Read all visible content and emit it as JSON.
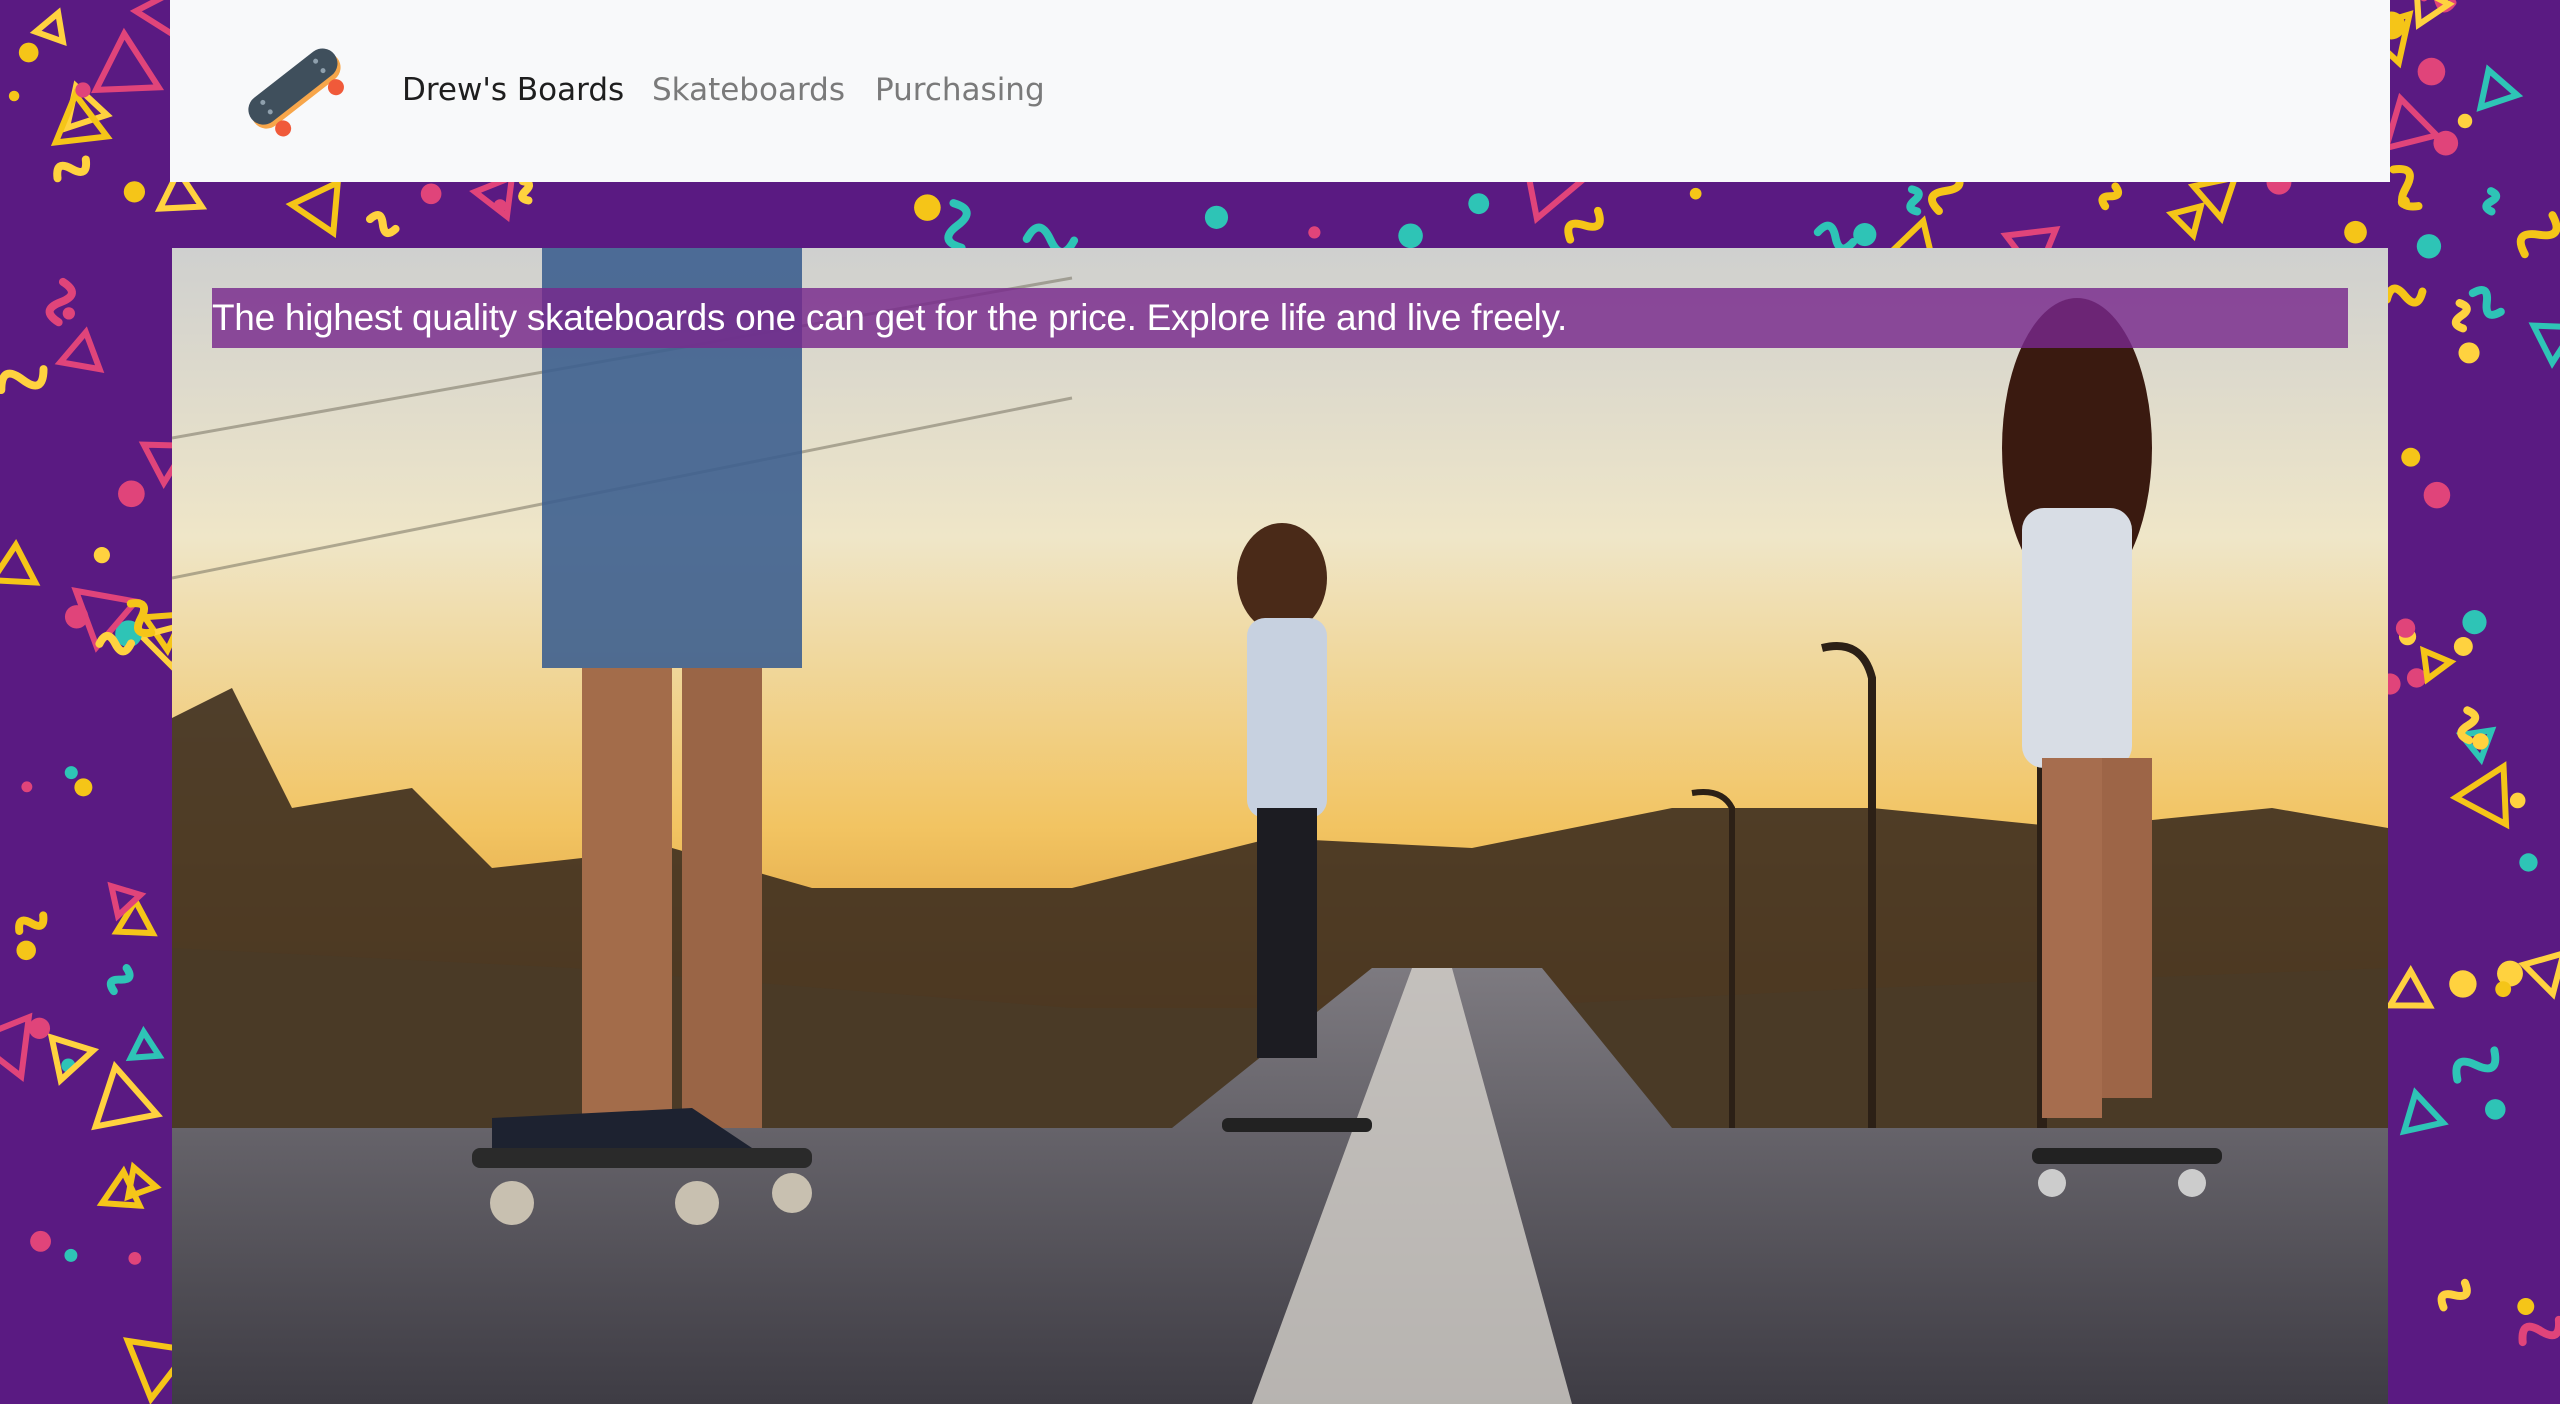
{
  "nav": {
    "brand_label": "Drew's Boards",
    "brand_icon": "skateboard-icon",
    "links": [
      {
        "label": "Skateboards"
      },
      {
        "label": "Purchasing"
      }
    ]
  },
  "hero": {
    "tagline": "The highest quality skateboards one can get for the price. Explore life and live freely."
  },
  "colors": {
    "background": "#5a1a82",
    "navbar": "#f8f9fa",
    "tagline_bg": "#7a2a8c",
    "confetti": [
      "#f5c518",
      "#e0447a",
      "#2ec4b6",
      "#ffd23f"
    ]
  }
}
